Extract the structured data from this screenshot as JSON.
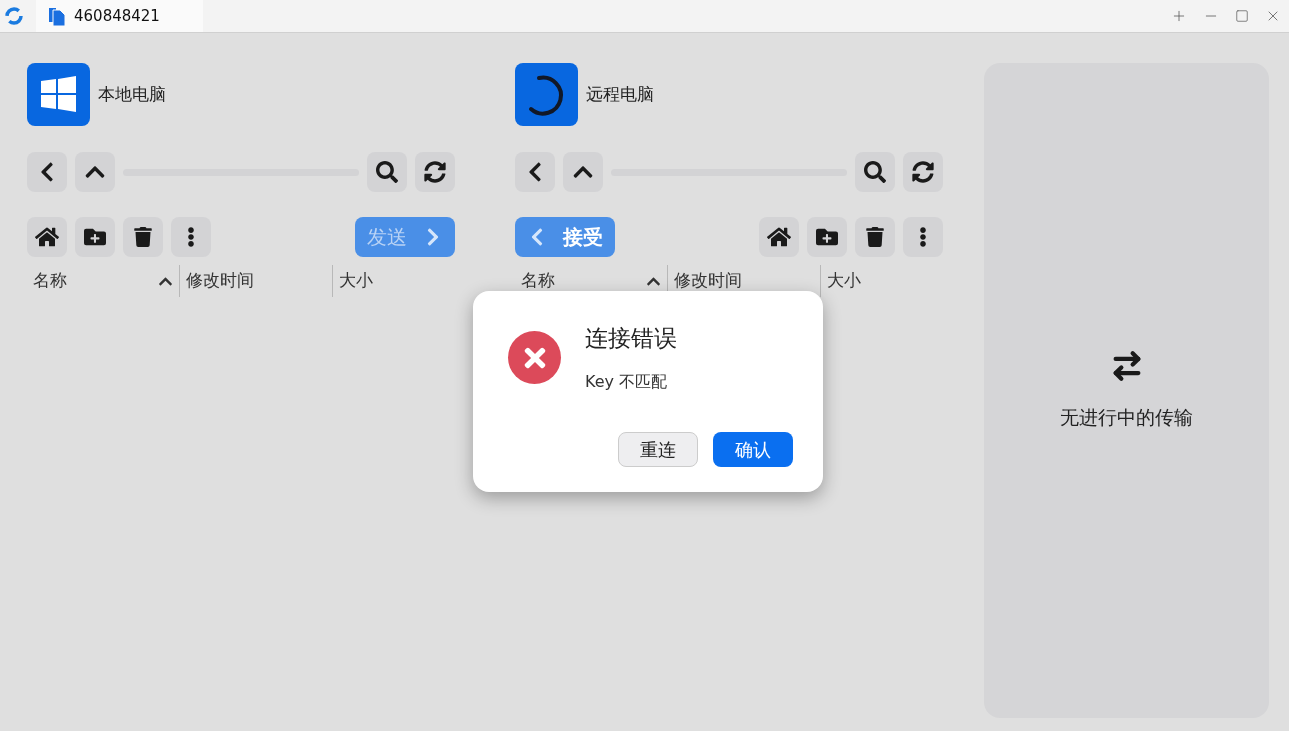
{
  "title_bar": {
    "tab_title": "460848421"
  },
  "panels": [
    {
      "kind": "local",
      "title": "本地电脑",
      "action": "发送",
      "columns": [
        {
          "label": "名称",
          "sorted": true
        },
        {
          "label": "修改时间",
          "sorted": false
        },
        {
          "label": "大小",
          "sorted": false
        }
      ]
    },
    {
      "kind": "remote",
      "title": "远程电脑",
      "action": "接受",
      "columns": [
        {
          "label": "名称",
          "sorted": true
        },
        {
          "label": "修改时间",
          "sorted": false
        },
        {
          "label": "大小",
          "sorted": false
        }
      ]
    }
  ],
  "transfers": {
    "empty_text": "无进行中的传输"
  },
  "dialog": {
    "title": "连接错误",
    "message": "Key 不匹配",
    "buttons": [
      {
        "label": "重连",
        "kind": "secondary"
      },
      {
        "label": "确认",
        "kind": "primary"
      }
    ]
  }
}
